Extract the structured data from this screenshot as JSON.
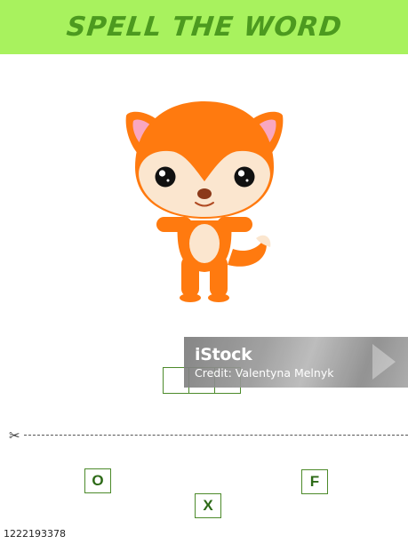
{
  "banner": {
    "title": "SPELL THE WORD"
  },
  "word_slots": {
    "count": 3
  },
  "letter_tiles": [
    {
      "letter": "O"
    },
    {
      "letter": "X"
    },
    {
      "letter": "F"
    }
  ],
  "watermark": {
    "brand": "iStock",
    "credit": "Credit: Valentyna Melnyk"
  },
  "scissors_icon": "scissors-icon",
  "stock_id": "1222193378",
  "colors": {
    "banner_bg": "#a8f25e",
    "banner_text": "#4c9a1f",
    "fox_orange": "#ff7a0f",
    "fox_cream": "#fbe6cf",
    "tile_border": "#4c8a2a"
  }
}
